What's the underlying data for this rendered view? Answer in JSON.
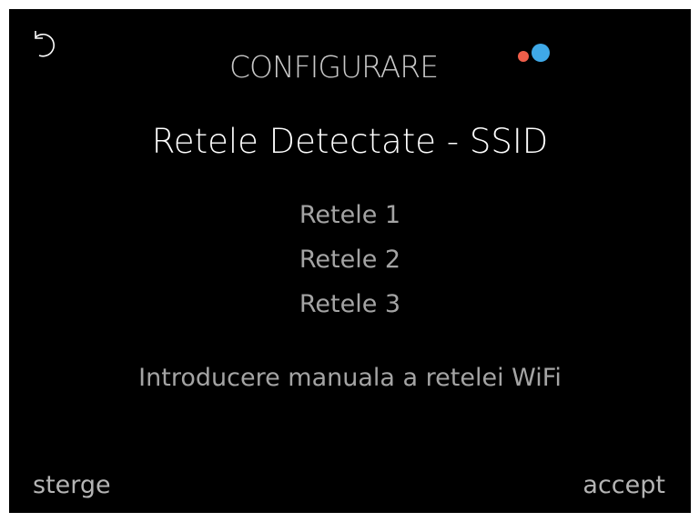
{
  "header": {
    "back_icon": "undo-arrow-icon",
    "title": "CONFIGURARE",
    "status_dots": {
      "colors": [
        "#ef5e4a",
        "#3fa9e8"
      ]
    }
  },
  "subtitle": "Retele Detectate - SSID",
  "networks": [
    {
      "label": "Retele 1"
    },
    {
      "label": "Retele 2"
    },
    {
      "label": "Retele 3"
    }
  ],
  "manual_entry": "Introducere manuala a retelei WiFi",
  "footer": {
    "delete_label": "sterge",
    "accept_label": "accept"
  }
}
